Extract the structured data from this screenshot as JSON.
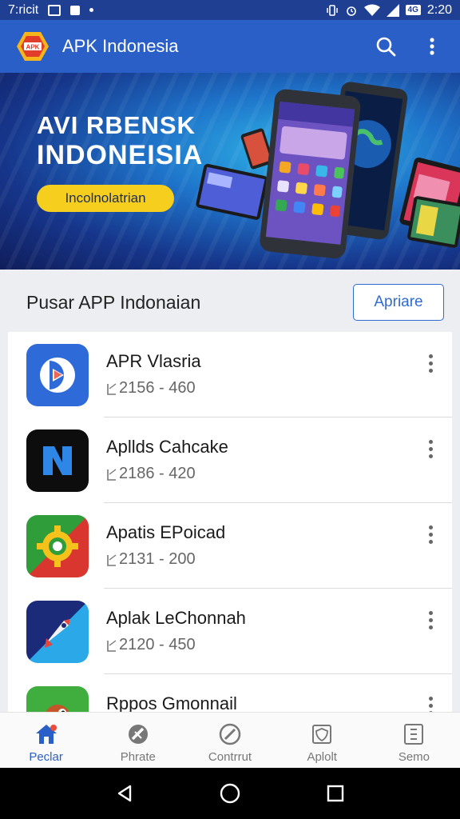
{
  "status_bar": {
    "left_text": "7:ricit",
    "time": "2:20",
    "battery": "4G"
  },
  "app_bar": {
    "logo_text": "APK",
    "title": "APK Indonesia"
  },
  "banner": {
    "title_line1": "AVI RBENSK",
    "title_line2": "INDONEISIA",
    "pill": "Incolnolatrian"
  },
  "section": {
    "title": "Pusar APP Indonaian",
    "button": "Apriare"
  },
  "apps": [
    {
      "name": "APR Vlasria",
      "meta": "2156 - 460",
      "icon": "video-app-icon"
    },
    {
      "name": "Apllds Cahcake",
      "meta": "2186 - 420",
      "icon": "n-app-icon"
    },
    {
      "name": "Apatis EPoicad",
      "meta": "2131 - 200",
      "icon": "gear-app-icon"
    },
    {
      "name": "Aplak LeChonnah",
      "meta": "2120 - 450",
      "icon": "rocket-app-icon"
    },
    {
      "name": "Rppos Gmonnail",
      "meta": "",
      "icon": "bird-app-icon"
    }
  ],
  "bottom_nav": [
    {
      "label": "Peclar",
      "icon": "home-icon"
    },
    {
      "label": "Phrate",
      "icon": "tools-icon"
    },
    {
      "label": "Contrrut",
      "icon": "compass-icon"
    },
    {
      "label": "Aplolt",
      "icon": "shield-icon"
    },
    {
      "label": "Semo",
      "icon": "card-icon"
    }
  ],
  "colors": {
    "primary": "#2a5fc7",
    "status": "#1f3f93",
    "accent": "#f6cf1e"
  }
}
